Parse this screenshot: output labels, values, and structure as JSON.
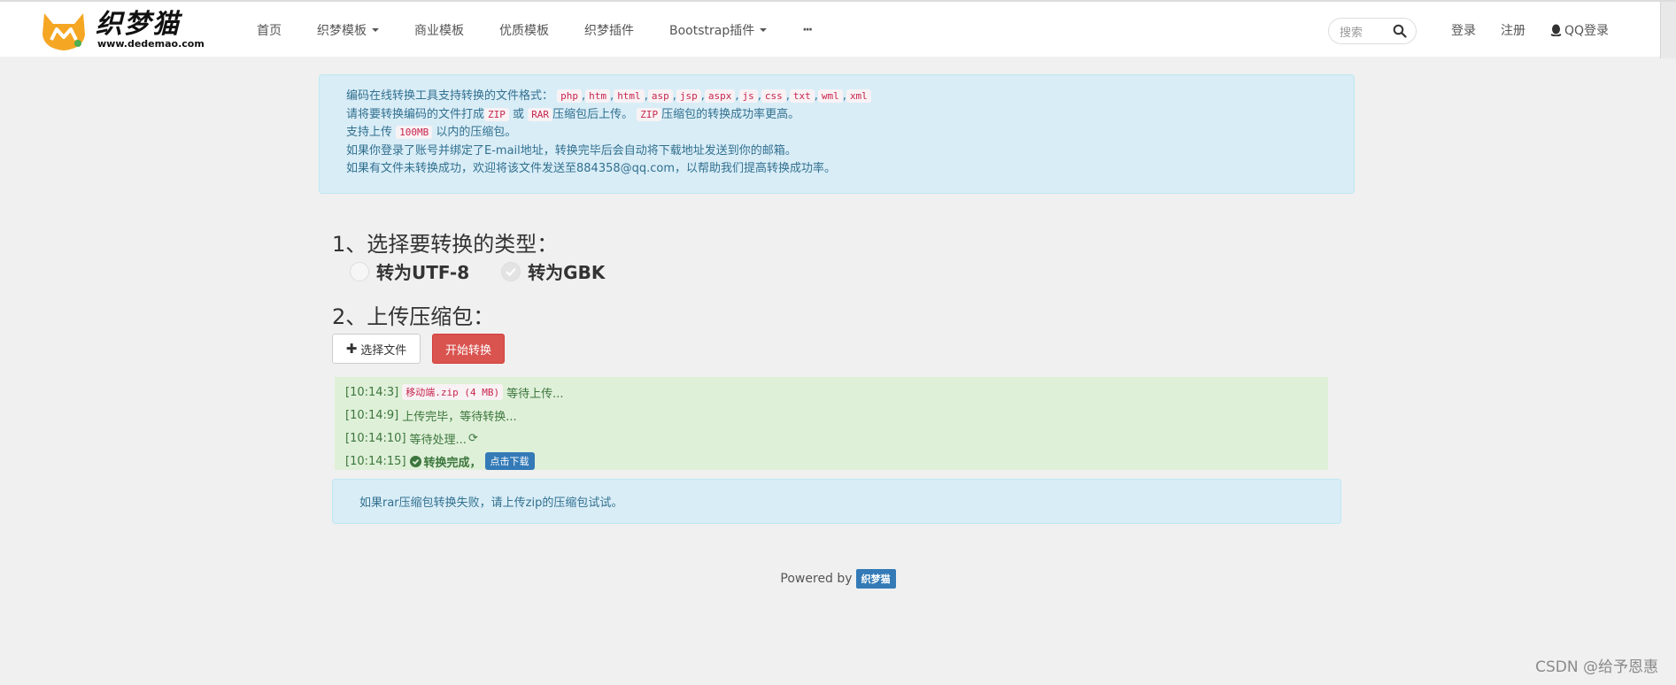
{
  "header": {
    "logo": {
      "cn": "织梦猫",
      "en": "www.dedemao.com"
    },
    "nav": [
      {
        "label": "首页",
        "dropdown": false
      },
      {
        "label": "织梦模板",
        "dropdown": true
      },
      {
        "label": "商业模板",
        "dropdown": false
      },
      {
        "label": "优质模板",
        "dropdown": false
      },
      {
        "label": "织梦插件",
        "dropdown": false
      },
      {
        "label": "Bootstrap插件",
        "dropdown": true
      },
      {
        "label": "···",
        "dropdown": false
      }
    ],
    "search": {
      "placeholder": "搜索"
    },
    "right": {
      "login": "登录",
      "register": "注册",
      "qq_login": "QQ登录"
    }
  },
  "info": {
    "line1_prefix": "编码在线转换工具支持转换的文件格式：",
    "formats": [
      "php",
      "htm",
      "html",
      "asp",
      "jsp",
      "aspx",
      "js",
      "css",
      "txt",
      "wml",
      "xml"
    ],
    "line2_a": "请将要转换编码的文件打成",
    "line2_zip": "ZIP",
    "line2_or": "或",
    "line2_rar": "RAR",
    "line2_b": "压缩包后上传。",
    "line2_zip2": "ZIP",
    "line2_c": "压缩包的转换成功率更高。",
    "line3_a": "支持上传",
    "line3_size": "100MB",
    "line3_b": "以内的压缩包。",
    "line4": "如果你登录了账号并绑定了E-mail地址，转换完毕后会自动将下载地址发送到你的邮箱。",
    "line5": "如果有文件未转换成功，欢迎将该文件发送至884358@qq.com，以帮助我们提高转换成功率。"
  },
  "step1": {
    "title": "1、选择要转换的类型：",
    "options": [
      {
        "label": "转为UTF-8",
        "checked": false
      },
      {
        "label": "转为GBK",
        "checked": true
      }
    ]
  },
  "step2": {
    "title": "2、上传压缩包：",
    "choose_file": "选择文件",
    "start": "开始转换"
  },
  "log": [
    {
      "time": "[10:14:3]",
      "file": "移动端.zip (4 MB)",
      "text": "等待上传..."
    },
    {
      "time": "[10:14:9]",
      "text": "上传完毕，等待转换..."
    },
    {
      "time": "[10:14:10]",
      "text": "等待处理..."
    },
    {
      "time": "[10:14:15]",
      "text": "转换完成，",
      "download": "点击下载"
    }
  ],
  "note": "如果rar压缩包转换失败，请上传zip的压缩包试试。",
  "footer": {
    "powered": "Powered by",
    "badge": "织梦猫"
  },
  "watermark": "CSDN @给予恩惠",
  "colors": {
    "accent": "#337ab7",
    "danger": "#d9534f",
    "info_bg": "#d9edf7",
    "success_bg": "#dff0d8",
    "logo_orange": "#f5a623"
  }
}
